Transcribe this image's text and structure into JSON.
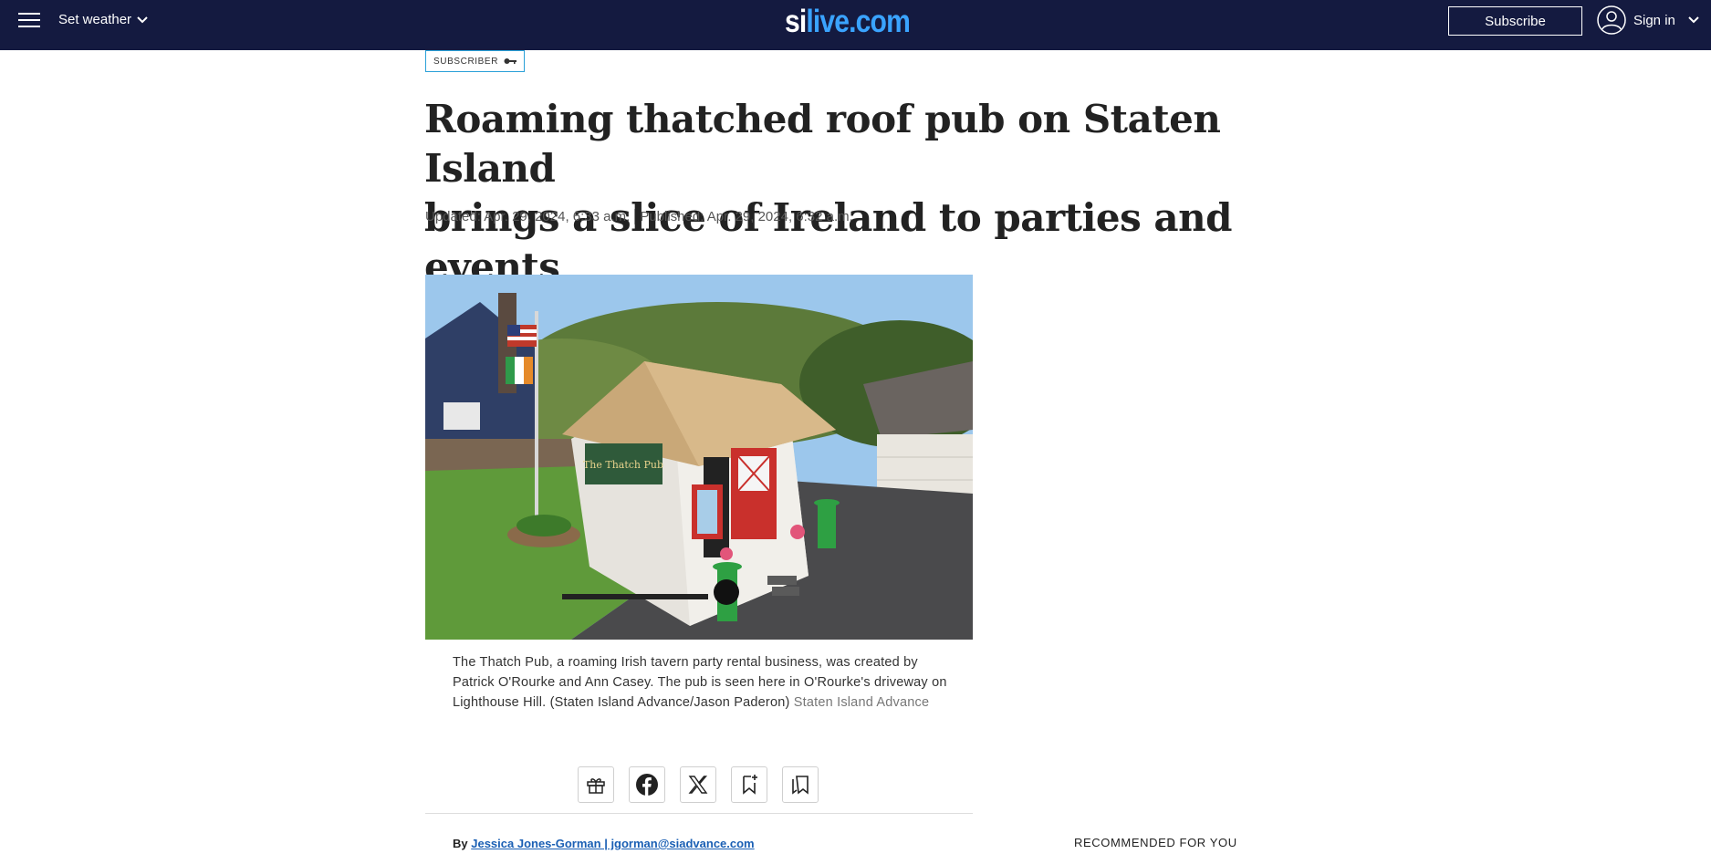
{
  "header": {
    "weather_label": "Set weather",
    "logo_si": "si",
    "logo_live": "live.com",
    "subscribe_label": "Subscribe",
    "signin_label": "Sign in"
  },
  "article": {
    "badge": "SUBSCRIBER",
    "headline_line1": "Roaming thatched roof pub on Staten Island",
    "headline_line2": "brings a slice of Ireland to parties and events",
    "updated": "Updated: Apr. 29, 2024, 6:33 a.m.",
    "published": "Published: Apr. 29, 2024, 6:32 a.m.",
    "caption": "The Thatch Pub, a roaming Irish tavern party rental business, was created by Patrick O'Rourke and Ann Casey. The pub is seen here in O'Rourke's driveway on Lighthouse Hill. (Staten Island Advance/Jason Paderon) ",
    "caption_credit": "Staten Island Advance",
    "pub_sign": "The Thatch Pub",
    "byline_prefix": "By ",
    "byline_author": "Jessica Jones-Gorman | jgorman@siadvance.com"
  },
  "share": {
    "icons": [
      "gift-icon",
      "facebook-icon",
      "x-icon",
      "bookmark-add-icon",
      "saved-list-icon"
    ]
  },
  "sidebar": {
    "recommended_label": "RECOMMENDED FOR YOU"
  },
  "colors": {
    "header_bg": "#141a40",
    "logo_accent": "#3aa3ff",
    "badge_border": "#2aa0d8",
    "link": "#1a5fb4"
  }
}
